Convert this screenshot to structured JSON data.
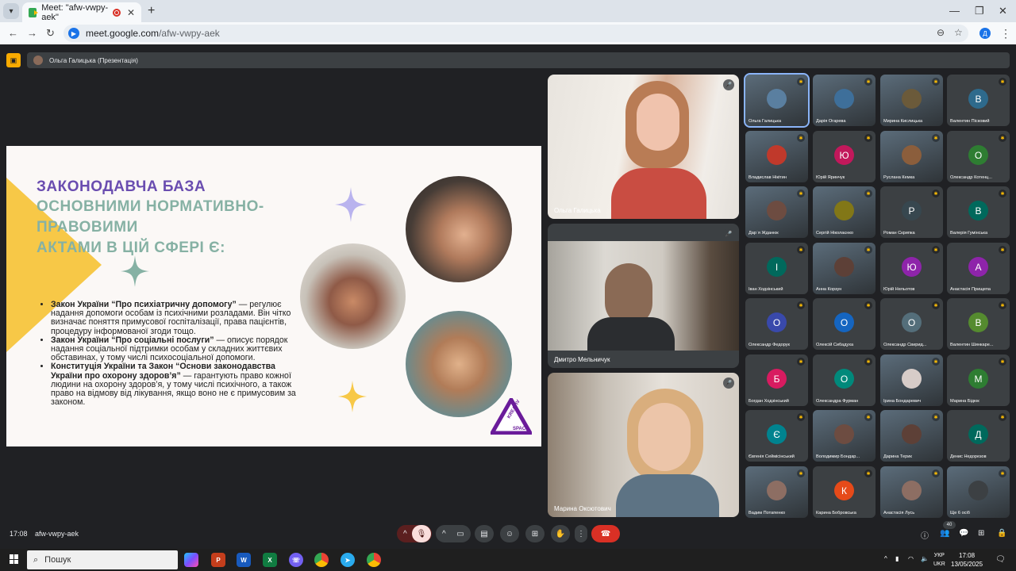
{
  "browser": {
    "tab_title": "Meet: \"afw-vwpy-aek\"",
    "url_host": "meet.google.com",
    "url_path": "/afw-vwpy-aek",
    "profile_initial": "Д"
  },
  "meet": {
    "presenter_label": "Ольга Галицька (Презентація)",
    "time": "17:08",
    "code": "afw-vwpy-aek",
    "participants_badge": "40"
  },
  "slide": {
    "title_line1": "ЗАКОНОДАВЧА БАЗА",
    "title_line2": "ОСНОВНИМИ НОРМАТИВНО-ПРАВОВИМИ",
    "title_line3": "АКТАМИ В ЦІЙ СФЕРІ Є:",
    "bullets": [
      {
        "bold": "Закон України “Про психіатричну допомогу”",
        "text": " — регулює надання допомоги особам із психічними розладами. Він чітко визначає поняття примусової госпіталізації, права пацієнтів, процедуру інформованої згоди тощо."
      },
      {
        "bold": "Закон України “Про соціальні послуги”",
        "text": " — описує порядок надання соціальної підтримки особам у складних життєвих обставинах, у тому числі психосоціальної допомоги."
      },
      {
        "bold": "Конституція України та Закон “Основи законодавства України про охорону здоров’я”",
        "text": " — гарантують право кожної людини на охорону здоров’я, у тому числі психічного, а також право на відмову від лікування, якщо воно не є примусовим за законом."
      }
    ],
    "logo_text_1": "KREATIV",
    "logo_text_2": "SPACE"
  },
  "main_tiles": [
    {
      "name": "Ольга Галицька"
    },
    {
      "name": "Дмитро Мельничук"
    },
    {
      "name": "Марина Оксютович"
    }
  ],
  "grid": [
    {
      "name": "Ольга Галицька",
      "initial": "",
      "color": "#5a7fa0"
    },
    {
      "name": "Дарія Огарева",
      "initial": "",
      "color": "#3e6f9a"
    },
    {
      "name": "Мирина Кислицька",
      "initial": "",
      "color": "#6b5a3a"
    },
    {
      "name": "Валентин Пісковий",
      "initial": "В",
      "color": "#2e6a8c"
    },
    {
      "name": "Владислав Нікітин",
      "initial": "",
      "color": "#c0392b"
    },
    {
      "name": "Юрій Яринчук",
      "initial": "Ю",
      "color": "#c2185b"
    },
    {
      "name": "Руслана Кемка",
      "initial": "",
      "color": "#8b5e3c"
    },
    {
      "name": "Олександр Котенц...",
      "initial": "О",
      "color": "#2e7d32"
    },
    {
      "name": "Дар`я Жданюк",
      "initial": "",
      "color": "#6d4c41"
    },
    {
      "name": "Сергій Ніколаєнко",
      "initial": "",
      "color": "#827717"
    },
    {
      "name": "Роман Скрипка",
      "initial": "Р",
      "color": "#37474f"
    },
    {
      "name": "Валерія Гумінська",
      "initial": "В",
      "color": "#00695c"
    },
    {
      "name": "Іван Ходзінський",
      "initial": "І",
      "color": "#00695c"
    },
    {
      "name": "Анна Корзун",
      "initial": "",
      "color": "#5d4037"
    },
    {
      "name": "Юрій Нельотов",
      "initial": "Ю",
      "color": "#8e24aa"
    },
    {
      "name": "Анастасія Прищепа",
      "initial": "А",
      "color": "#8e24aa"
    },
    {
      "name": "Олександр Федорук",
      "initial": "О",
      "color": "#3949ab"
    },
    {
      "name": "Олексій Сибадуха",
      "initial": "О",
      "color": "#1565c0"
    },
    {
      "name": "Олександр Свирид...",
      "initial": "О",
      "color": "#546e7a"
    },
    {
      "name": "Валентин Шинкаре...",
      "initial": "В",
      "color": "#558b2f"
    },
    {
      "name": "Богдан Ходзінський",
      "initial": "Б",
      "color": "#d81b60"
    },
    {
      "name": "Олександра Фурман",
      "initial": "О",
      "color": "#00897b"
    },
    {
      "name": "Ірина Бондаревич",
      "initial": "",
      "color": "#d7ccc8"
    },
    {
      "name": "Марина Бідюк",
      "initial": "М",
      "color": "#2e7d32"
    },
    {
      "name": "Євгенія Сеймісінський",
      "initial": "Є",
      "color": "#00838f"
    },
    {
      "name": "Володимир Бондар...",
      "initial": "",
      "color": "#6d4c41"
    },
    {
      "name": "Дарина Терик",
      "initial": "",
      "color": "#5d4037"
    },
    {
      "name": "Денис Недорезов",
      "initial": "Д",
      "color": "#00695c"
    },
    {
      "name": "Вадим Потапенко",
      "initial": "",
      "color": "#8d6e63"
    },
    {
      "name": "Карина Бобровська",
      "initial": "К",
      "color": "#e64a19"
    },
    {
      "name": "Анастасія Лусь",
      "initial": "",
      "color": "#8d6e63"
    },
    {
      "name": "Ще 6 осіб",
      "initial": "",
      "color": "#3c4043"
    }
  ],
  "taskbar": {
    "search_label": "Пошук",
    "lang_top": "УКР",
    "lang_bottom": "UKR",
    "time": "17:08",
    "date": "13/05/2025"
  }
}
